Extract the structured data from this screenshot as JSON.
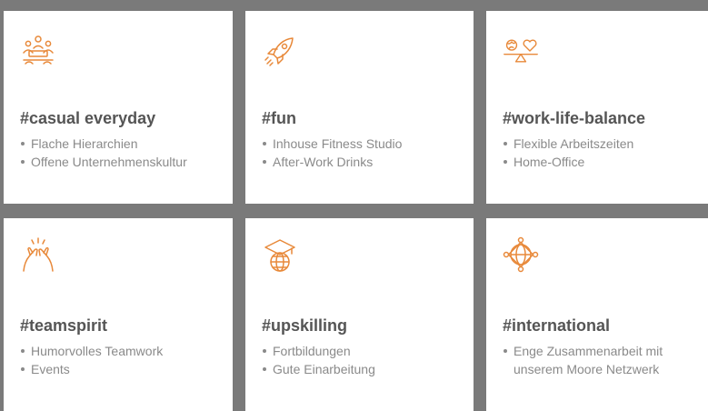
{
  "accent_color": "#e8893a",
  "cards": [
    {
      "icon": "meeting-people-icon",
      "title": "#casual everyday",
      "items": [
        "Flache Hierarchien",
        "Offene Unternehmenskultur"
      ]
    },
    {
      "icon": "rocket-icon",
      "title": "#fun",
      "items": [
        "Inhouse Fitness Studio",
        "After-Work Drinks"
      ]
    },
    {
      "icon": "balance-scale-icon",
      "title": "#work-life-balance",
      "items": [
        "Flexible Arbeitszeiten",
        "Home-Office"
      ]
    },
    {
      "icon": "high-five-icon",
      "title": "#teamspirit",
      "items": [
        "Humorvolles Teamwork",
        "Events"
      ]
    },
    {
      "icon": "graduation-globe-icon",
      "title": "#upskilling",
      "items": [
        "Fortbildungen",
        "Gute Einarbeitung"
      ]
    },
    {
      "icon": "network-globe-icon",
      "title": "#international",
      "items": [
        "Enge Zusammenarbeit mit unserem Moore Netzwerk"
      ]
    }
  ]
}
